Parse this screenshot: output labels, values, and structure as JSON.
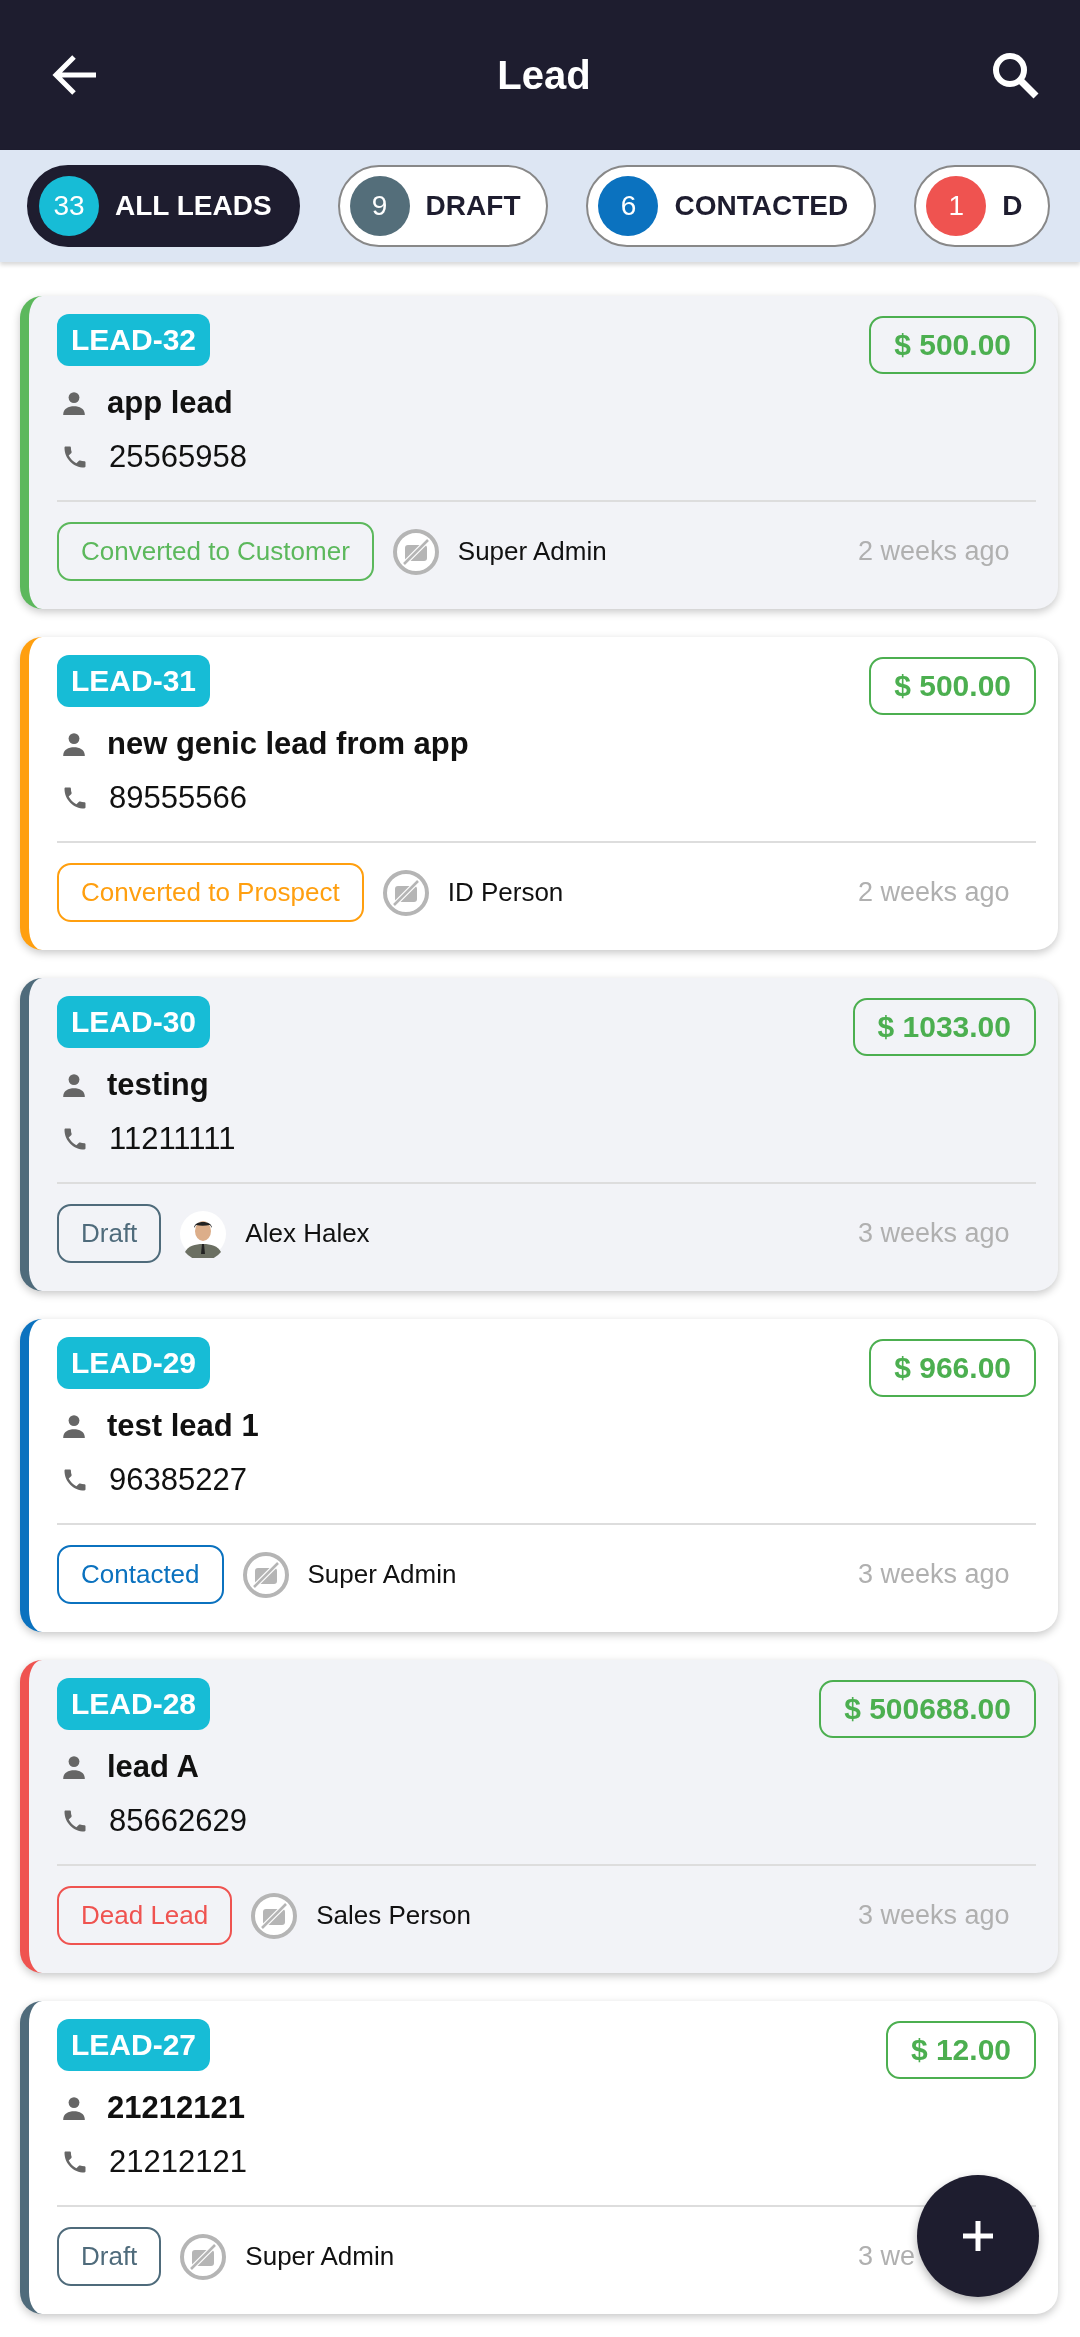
{
  "header": {
    "title": "Lead"
  },
  "tabs": [
    {
      "count": "33",
      "label": "ALL LEADS",
      "color": "#17bcd6",
      "selected": true
    },
    {
      "count": "9",
      "label": "DRAFT",
      "color": "#546e7a",
      "selected": false
    },
    {
      "count": "6",
      "label": "CONTACTED",
      "color": "#0b72bf",
      "selected": false
    },
    {
      "count": "1",
      "label": "D",
      "color": "#ef5350",
      "selected": false
    }
  ],
  "leads": [
    {
      "code": "LEAD-32",
      "amount": "$ 500.00",
      "name": "app lead",
      "phone": "25565958",
      "status": "Converted to Customer",
      "color": "#5cb85c",
      "owner": "Super Admin",
      "avatar": {
        "kind": "placeholder"
      },
      "time": "2 weeks ago",
      "shaded": true
    },
    {
      "code": "LEAD-31",
      "amount": "$ 500.00",
      "name": "new genic lead from app",
      "phone": "89555566",
      "status": "Converted to Prospect",
      "color": "#ff9f0f",
      "owner": "ID Person",
      "avatar": {
        "kind": "placeholder"
      },
      "time": "2 weeks ago",
      "shaded": false
    },
    {
      "code": "LEAD-30",
      "amount": "$ 1033.00",
      "name": "testing",
      "phone": "11211111",
      "status": "Draft",
      "color": "#4f6b7b",
      "owner": "Alex Halex",
      "avatar": {
        "kind": "photo"
      },
      "time": "3 weeks ago",
      "shaded": true
    },
    {
      "code": "LEAD-29",
      "amount": "$ 966.00",
      "name": "test lead 1",
      "phone": "96385227",
      "status": "Contacted",
      "color": "#0b72bf",
      "owner": "Super Admin",
      "avatar": {
        "kind": "placeholder"
      },
      "time": "3 weeks ago",
      "shaded": false
    },
    {
      "code": "LEAD-28",
      "amount": "$ 500688.00",
      "name": "lead A",
      "phone": "85662629",
      "status": "Dead Lead",
      "color": "#ef5350",
      "owner": "Sales Person",
      "avatar": {
        "kind": "placeholder"
      },
      "time": "3 weeks ago",
      "shaded": true
    },
    {
      "code": "LEAD-27",
      "amount": "$ 12.00",
      "name": "21212121",
      "phone": "21212121",
      "status": "Draft",
      "color": "#4f6b7b",
      "owner": "Super Admin",
      "avatar": {
        "kind": "placeholder"
      },
      "time": "3 we",
      "shaded": false
    }
  ]
}
